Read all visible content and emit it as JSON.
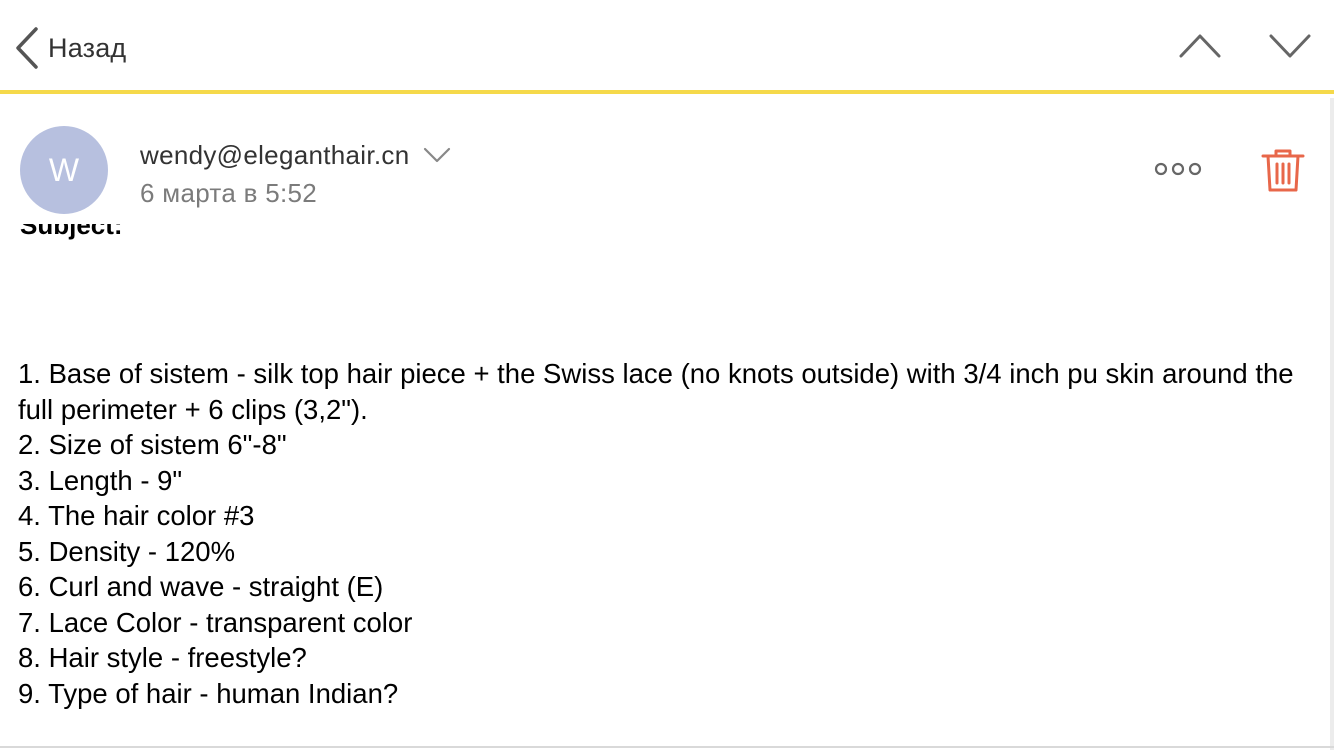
{
  "topbar": {
    "back_label": "Назад",
    "back_icon": "chevron-left-icon",
    "prev_icon": "chevron-up-icon",
    "next_icon": "chevron-down-icon",
    "accent_color": "#f5d94a"
  },
  "message": {
    "avatar_initial": "W",
    "avatar_color": "#b7c0df",
    "sender_email": "wendy@eleganthair.cn",
    "date": "6 марта в 5:52",
    "subject_partial": "Subject:",
    "more_icon": "more-dots-icon",
    "delete_icon": "trash-icon",
    "delete_color": "#e8674a"
  },
  "body": {
    "lines": [
      "1. Base of sistem - silk top hair piece + the Swiss lace (no knots outside) with 3/4 inch pu skin around the full perimeter + 6 clips (3,2\").",
      "2. Size of sistem 6\"-8\"",
      "3. Length - 9\"",
      "4. The hair color #3",
      "5. Density - 120%",
      "6. Curl and wave - straight (E)",
      "7. Lace Color - transparent color",
      "8. Hair style - freestyle?",
      "9. Type of hair - human Indian?"
    ]
  }
}
